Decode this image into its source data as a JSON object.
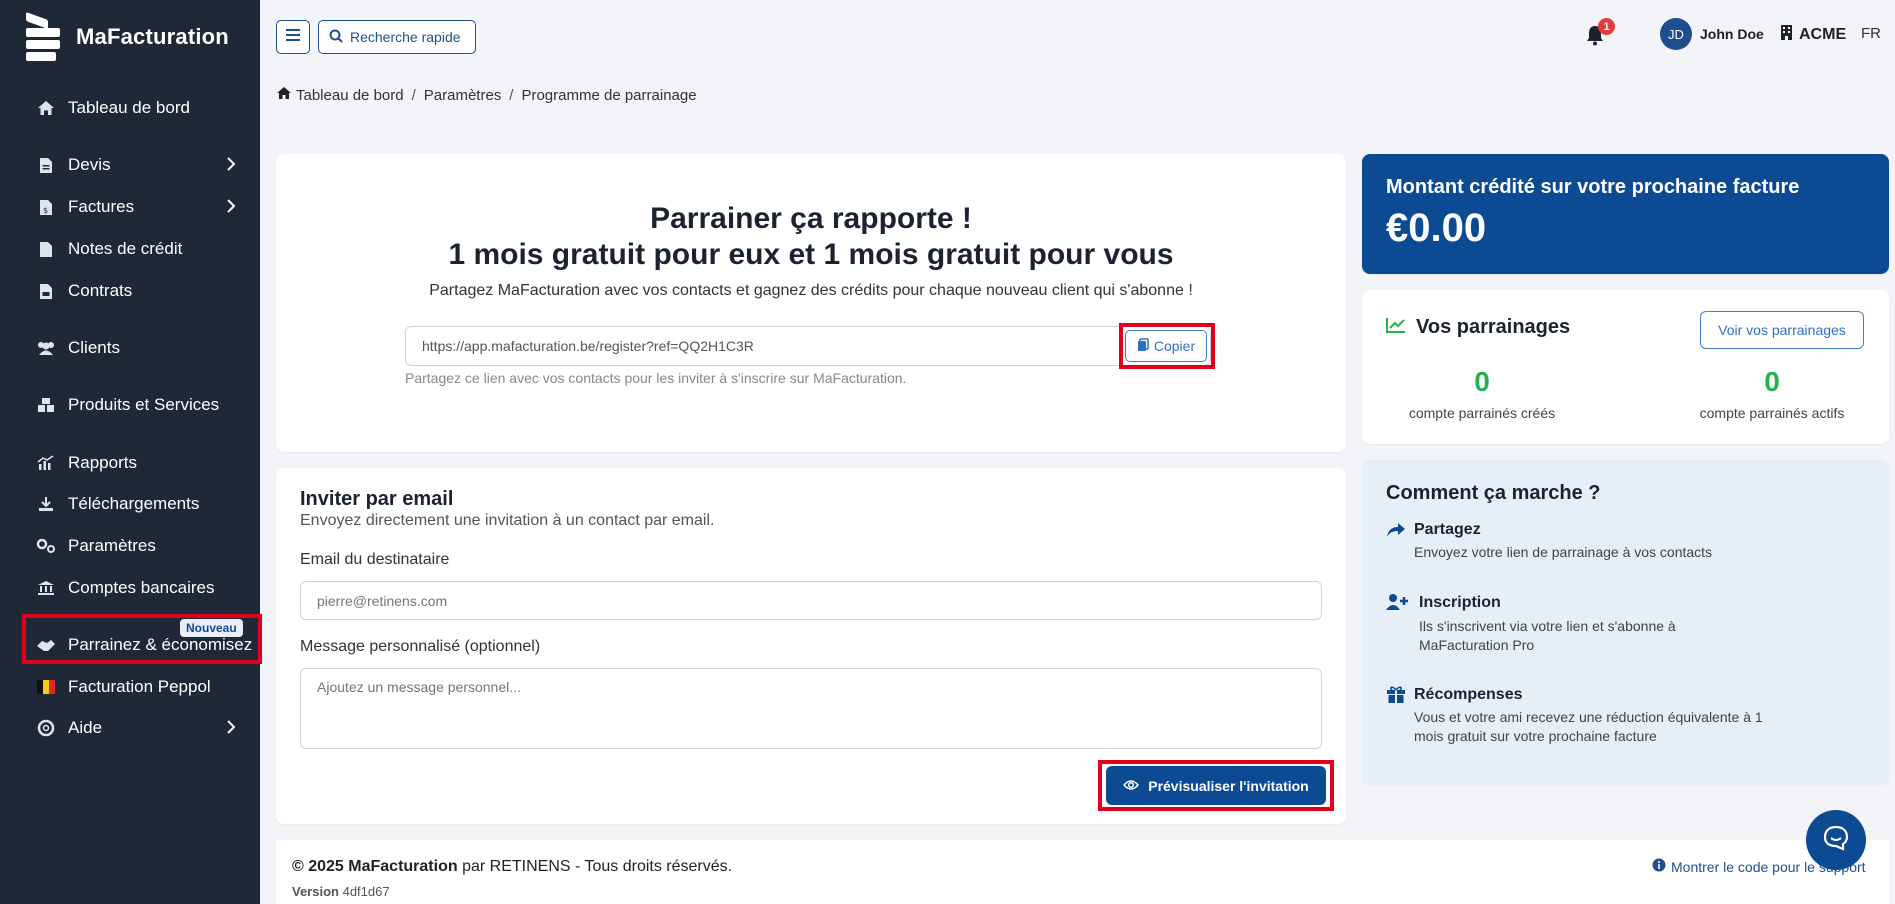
{
  "app": {
    "name": "MaFacturation"
  },
  "sidebar": {
    "items": [
      {
        "label": "Tableau de bord"
      },
      {
        "label": "Devis"
      },
      {
        "label": "Factures"
      },
      {
        "label": "Notes de crédit"
      },
      {
        "label": "Contrats"
      },
      {
        "label": "Clients"
      },
      {
        "label": "Produits et Services"
      },
      {
        "label": "Rapports"
      },
      {
        "label": "Téléchargements"
      },
      {
        "label": "Paramètres"
      },
      {
        "label": "Comptes bancaires"
      },
      {
        "label": "Parrainez & économisez",
        "badge": "Nouveau"
      },
      {
        "label": "Facturation Peppol"
      },
      {
        "label": "Aide"
      }
    ]
  },
  "topbar": {
    "search_label": "Recherche rapide",
    "notification_count": "1",
    "user_initials": "JD",
    "user_name": "John Doe",
    "company": "ACME",
    "lang": "FR"
  },
  "breadcrumb": [
    "Tableau de bord",
    "Paramètres",
    "Programme de parrainage"
  ],
  "referral": {
    "title_line1": "Parrainer ça rapporte !",
    "title_line2": "1 mois gratuit pour eux et 1 mois gratuit pour vous",
    "subtitle": "Partagez MaFacturation avec vos contacts et gagnez des crédits pour chaque nouveau client qui s'abonne !",
    "link": "https://app.mafacturation.be/register?ref=QQ2H1C3R",
    "copy_label": "Copier",
    "help": "Partagez ce lien avec vos contacts pour les inviter à s'inscrire sur MaFacturation."
  },
  "invite": {
    "title": "Inviter par email",
    "subtitle": "Envoyez directement une invitation à un contact par email.",
    "email_label": "Email du destinataire",
    "email_placeholder": "pierre@retinens.com",
    "message_label": "Message personnalisé (optionnel)",
    "message_placeholder": "Ajoutez un message personnel...",
    "preview_label": "Prévisualiser l'invitation"
  },
  "credit": {
    "label": "Montant crédité sur votre prochaine facture",
    "value": "€0.00"
  },
  "referrals_stats": {
    "title": "Vos parrainages",
    "view_label": "Voir vos parrainages",
    "created_value": "0",
    "created_label": "compte parrainés créés",
    "active_value": "0",
    "active_label": "compte parrainés actifs"
  },
  "how": {
    "title": "Comment ça marche ?",
    "steps": [
      {
        "title": "Partagez",
        "desc": "Envoyez votre lien de parrainage à vos contacts"
      },
      {
        "title": "Inscription",
        "desc": "Ils s'inscrivent via votre lien et s'abonne à MaFacturation Pro"
      },
      {
        "title": "Récompenses",
        "desc": "Vous et votre ami recevez une réduction équivalente à 1 mois gratuit sur votre prochaine facture"
      }
    ]
  },
  "footer": {
    "copyright_prefix": "© 2025 MaFacturation",
    "copyright_suffix": " par RETINENS - Tous droits réservés.",
    "version_label": "Version",
    "version_value": "4df1d67",
    "show_code": "Montrer le code pour le support"
  },
  "colors": {
    "sidebar_bg": "#1e2836",
    "primary": "#0d4a94",
    "success": "#27b04e",
    "highlight": "#e0001b"
  }
}
